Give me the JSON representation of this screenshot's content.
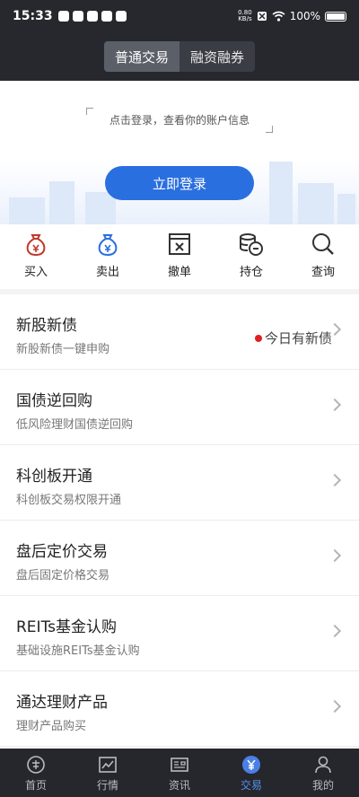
{
  "status_bar": {
    "time": "15:33",
    "net_speed_value": "0.80",
    "net_speed_unit": "KB/s",
    "battery": "100%"
  },
  "header": {
    "tabs": [
      "普通交易",
      "融资融券"
    ],
    "active_tab": "普通交易"
  },
  "login": {
    "hint": "点击登录，查看你的账户信息",
    "button": "立即登录"
  },
  "quick_actions": [
    {
      "label": "买入",
      "icon": "buy-money-bag-icon"
    },
    {
      "label": "卖出",
      "icon": "sell-money-bag-icon"
    },
    {
      "label": "撤单",
      "icon": "cancel-order-icon"
    },
    {
      "label": "持仓",
      "icon": "holdings-coins-icon"
    },
    {
      "label": "查询",
      "icon": "search-icon"
    }
  ],
  "menu": [
    {
      "title": "新股新债",
      "subtitle": "新股新债一键申购",
      "tag": "今日有新债"
    },
    {
      "title": "国债逆回购",
      "subtitle": "低风险理财国债逆回购"
    },
    {
      "title": "科创板开通",
      "subtitle": "科创板交易权限开通"
    },
    {
      "title": "盘后定价交易",
      "subtitle": "盘后固定价格交易"
    },
    {
      "title": "REITs基金认购",
      "subtitle": "基础设施REITs基金认购"
    },
    {
      "title": "通达理财产品",
      "subtitle": "理财产品购买"
    }
  ],
  "bottom_nav": [
    {
      "label": "首页",
      "icon": "home-icon"
    },
    {
      "label": "行情",
      "icon": "market-chart-icon"
    },
    {
      "label": "资讯",
      "icon": "news-icon"
    },
    {
      "label": "交易",
      "icon": "trade-yuan-icon"
    },
    {
      "label": "我的",
      "icon": "profile-icon"
    }
  ],
  "active_nav": "交易",
  "colors": {
    "dark_bg": "#26282d",
    "accent_blue": "#2a6fe0",
    "red_dot": "#e02020",
    "nav_active": "#5a8ff0"
  }
}
